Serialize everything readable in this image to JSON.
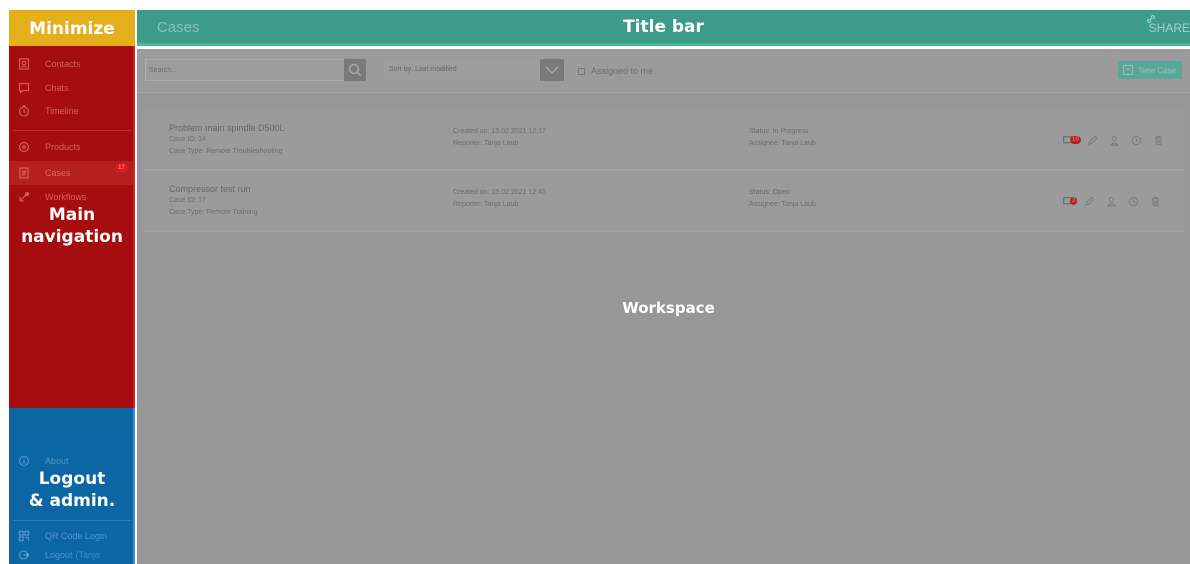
{
  "zones": {
    "minimize": "Minimize",
    "title_bar": "Title bar",
    "main_navigation": "Main\nnavigation",
    "logout_admin": "Logout\n& admin.",
    "workspace": "Workspace"
  },
  "colors": {
    "minimize": "#e3b01c",
    "main_navigation": "#a50d0e",
    "logout_admin": "#0c66a4",
    "title_bar": "#3f9b89",
    "workspace": "#979797"
  },
  "title_bar": {
    "page_title": "Cases",
    "share_label": "SHARE",
    "share_icon": "link-icon"
  },
  "nav": {
    "items": [
      {
        "label": "Contacts",
        "icon": "contacts-icon"
      },
      {
        "label": "Chats",
        "icon": "chat-icon"
      },
      {
        "label": "Timeline",
        "icon": "clock-icon"
      },
      {
        "label": "Products",
        "icon": "products-icon"
      },
      {
        "label": "Cases",
        "icon": "cases-icon",
        "badge": "17",
        "active": true
      },
      {
        "label": "Workflows",
        "icon": "workflows-icon"
      }
    ]
  },
  "admin": {
    "items": [
      {
        "label": "About",
        "icon": "info-icon"
      },
      {
        "label": "QR Code Login",
        "icon": "qr-code-icon"
      },
      {
        "label": "Logout",
        "sub": "(Tanja",
        "icon": "logout-icon"
      }
    ]
  },
  "toolbar": {
    "search_placeholder": "Search...",
    "sort_label": "Sort by: Last modified",
    "assigned_label": "Assigned to me",
    "new_case_label": "New Case"
  },
  "cases": [
    {
      "title": "Problem main spindle D500L",
      "case_id": "Case ID: 14",
      "case_type": "Case Type: Remote Troubleshooting",
      "created": "Created on: 15.02.2021 12:17",
      "reporter": "Reporter: Tanja Laub",
      "status": "Status: In Progress",
      "assignee": "Assignee: Tanja Laub",
      "chat_count": "10"
    },
    {
      "title": "Compressor test run",
      "case_id": "Case ID: 17",
      "case_type": "Case Type: Remote Training",
      "created": "Created on: 15.02.2021 12:42",
      "reporter": "Reporter: Tanja Laub",
      "status": "Status: Open",
      "assignee": "Assignee: Tanja Laub",
      "chat_count": "2"
    }
  ]
}
